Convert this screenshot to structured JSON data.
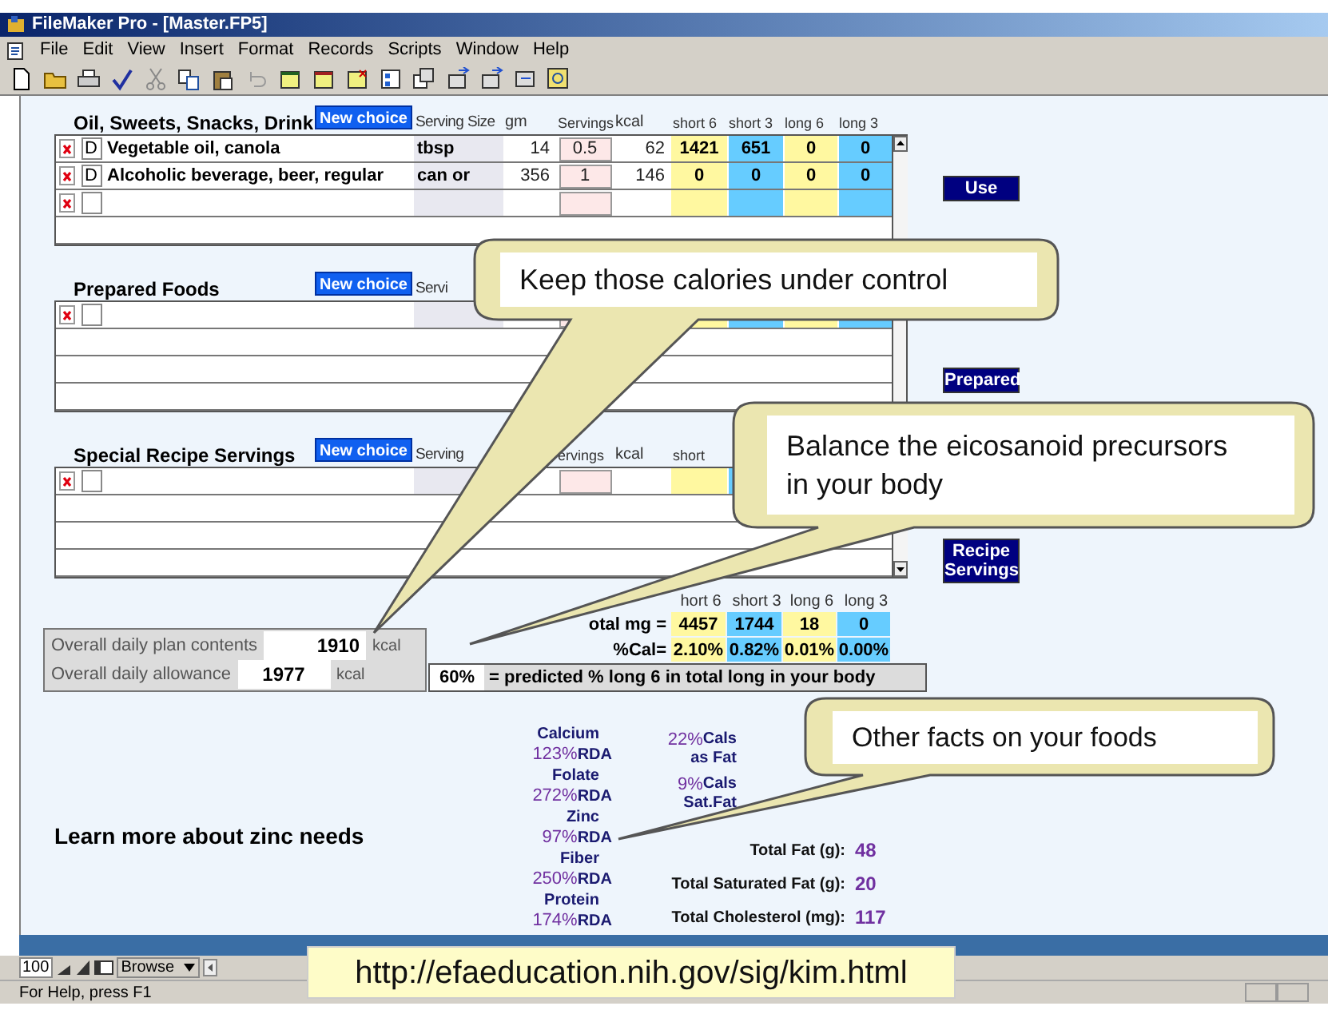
{
  "window": {
    "title": "FileMaker Pro - [Master.FP5]"
  },
  "menu": [
    "File",
    "Edit",
    "View",
    "Insert",
    "Format",
    "Records",
    "Scripts",
    "Window",
    "Help"
  ],
  "sections": [
    {
      "title": "Oil, Sweets, Snacks, Drink",
      "button": "New choice",
      "side_button": "Use",
      "headers": [
        "Serving Size",
        "gm",
        "Servings",
        "kcal",
        "short 6",
        "short 3",
        "long 6",
        "long 3"
      ],
      "rows": [
        {
          "kind": "entry",
          "flag": "D",
          "name": "Vegetable oil, canola",
          "unit": "tbsp",
          "gm": "14",
          "servings": "0.5",
          "kcal": "62",
          "short6": "1421",
          "short3": "651",
          "long6": "0",
          "long3": "0"
        },
        {
          "kind": "entry",
          "flag": "D",
          "name": "Alcoholic beverage, beer, regular",
          "unit": "can or",
          "gm": "356",
          "servings": "1",
          "kcal": "146",
          "short6": "0",
          "short3": "0",
          "long6": "0",
          "long3": "0"
        },
        {
          "kind": "new"
        },
        {
          "kind": "empty"
        }
      ]
    },
    {
      "title": "Prepared Foods",
      "button": "New choice",
      "side_button": "Prepared",
      "headers": [
        "Servi"
      ],
      "rows": [
        {
          "kind": "new"
        },
        {
          "kind": "empty"
        },
        {
          "kind": "empty"
        },
        {
          "kind": "empty"
        }
      ]
    },
    {
      "title": "Special Recipe Servings",
      "button": "New choice",
      "side_button": "Recipe Servings",
      "headers": [
        "Serving",
        "ervings",
        "kcal",
        "short"
      ],
      "rows": [
        {
          "kind": "new"
        },
        {
          "kind": "empty"
        },
        {
          "kind": "empty"
        },
        {
          "kind": "empty"
        }
      ]
    }
  ],
  "plan": [
    {
      "label": "Overall daily plan contents",
      "value": "1910",
      "unit": "kcal"
    },
    {
      "label": "Overall daily allowance",
      "value": "1977",
      "unit": "kcal"
    }
  ],
  "totals": {
    "headers": [
      "hort 6",
      "short 3",
      "long 6",
      "long 3"
    ],
    "rows": [
      {
        "label": "otal mg =",
        "values": [
          "4457",
          "1744",
          "18",
          "0"
        ]
      },
      {
        "label": "%Cal=",
        "values": [
          "2.10%",
          "0.82%",
          "0.01%",
          "0.00%"
        ]
      }
    ]
  },
  "predicted": {
    "value": "60%",
    "text": "= predicted % long 6 in total long in your body"
  },
  "learn_link": "Learn more about zinc needs",
  "nutrients": [
    {
      "name": "Calcium",
      "percent": "123%",
      "unit": "RDA"
    },
    {
      "name": "Folate",
      "percent": "272%",
      "unit": "RDA"
    },
    {
      "name": "Zinc",
      "percent": "97%",
      "unit": "RDA"
    },
    {
      "name": "Fiber",
      "percent": "250%",
      "unit": "RDA"
    },
    {
      "name": "Protein",
      "percent": "174%",
      "unit": "RDA"
    }
  ],
  "calories": [
    {
      "percent": "22%",
      "line1": "Cals",
      "line2": "as Fat"
    },
    {
      "percent": "9%",
      "line1": "Cals",
      "line2": "Sat.Fat"
    }
  ],
  "fat_totals": [
    {
      "label": "Total Fat (g):",
      "value": "48"
    },
    {
      "label": "Total Saturated Fat (g):",
      "value": "20"
    },
    {
      "label": "Total Cholesterol (mg):",
      "value": "117"
    }
  ],
  "callouts": [
    "Keep those calories under control",
    "Balance the eicosanoid precursors in your body",
    "Other facts on your foods"
  ],
  "url": "http://efaeducation.nih.gov/sig/kim.html",
  "browse_bar": {
    "zoom": "100",
    "mode": "Browse"
  },
  "status_bar": "For Help, press F1"
}
